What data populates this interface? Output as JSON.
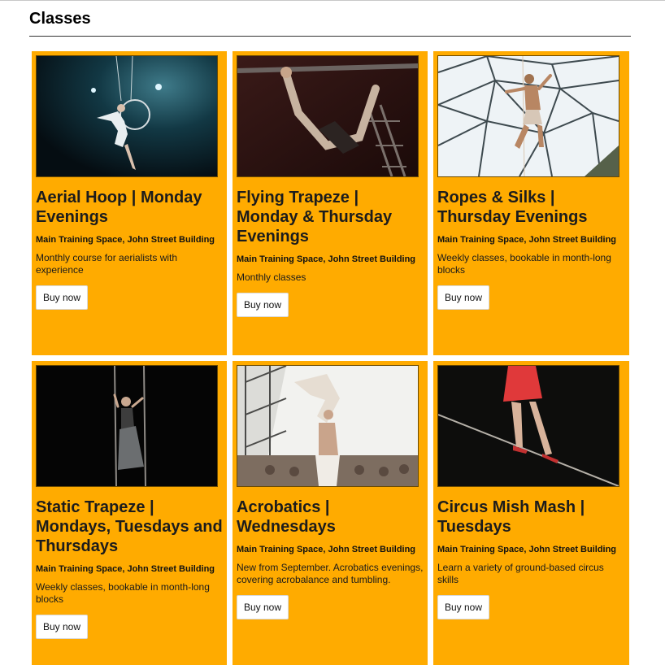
{
  "section": {
    "title": "Classes"
  },
  "classes": [
    {
      "title": "Aerial Hoop | Monday Evenings",
      "venue": "Main Training Space, John Street Building",
      "description": "Monthly course for aerialists with experience",
      "button_label": "Buy now",
      "image_icon": "aerial-hoop-photo"
    },
    {
      "title": "Flying Trapeze | Monday & Thursday Evenings",
      "venue": "Main Training Space, John Street Building",
      "description": "Monthly classes",
      "button_label": "Buy now",
      "image_icon": "flying-trapeze-photo"
    },
    {
      "title": "Ropes & Silks | Thursday Evenings",
      "venue": "Main Training Space, John Street Building",
      "description": "Weekly classes, bookable in month-long blocks",
      "button_label": "Buy now",
      "image_icon": "ropes-silks-photo"
    },
    {
      "title": "Static Trapeze | Mondays, Tuesdays and Thursdays",
      "venue": "Main Training Space, John Street Building",
      "description": "Weekly classes, bookable in month-long blocks",
      "button_label": "Buy now",
      "image_icon": "static-trapeze-photo"
    },
    {
      "title": "Acrobatics | Wednesdays",
      "venue": "Main Training Space, John Street Building",
      "description": "New from September. Acrobatics evenings, covering acrobalance and tumbling.",
      "button_label": "Buy now",
      "image_icon": "acrobatics-photo"
    },
    {
      "title": "Circus Mish Mash | Tuesdays",
      "venue": "Main Training Space, John Street Building",
      "description": "Learn a variety of ground-based circus skills",
      "button_label": "Buy now",
      "image_icon": "circus-mish-mash-photo"
    }
  ],
  "colors": {
    "card_background": "#ffab00",
    "button_background": "#ffffff"
  }
}
